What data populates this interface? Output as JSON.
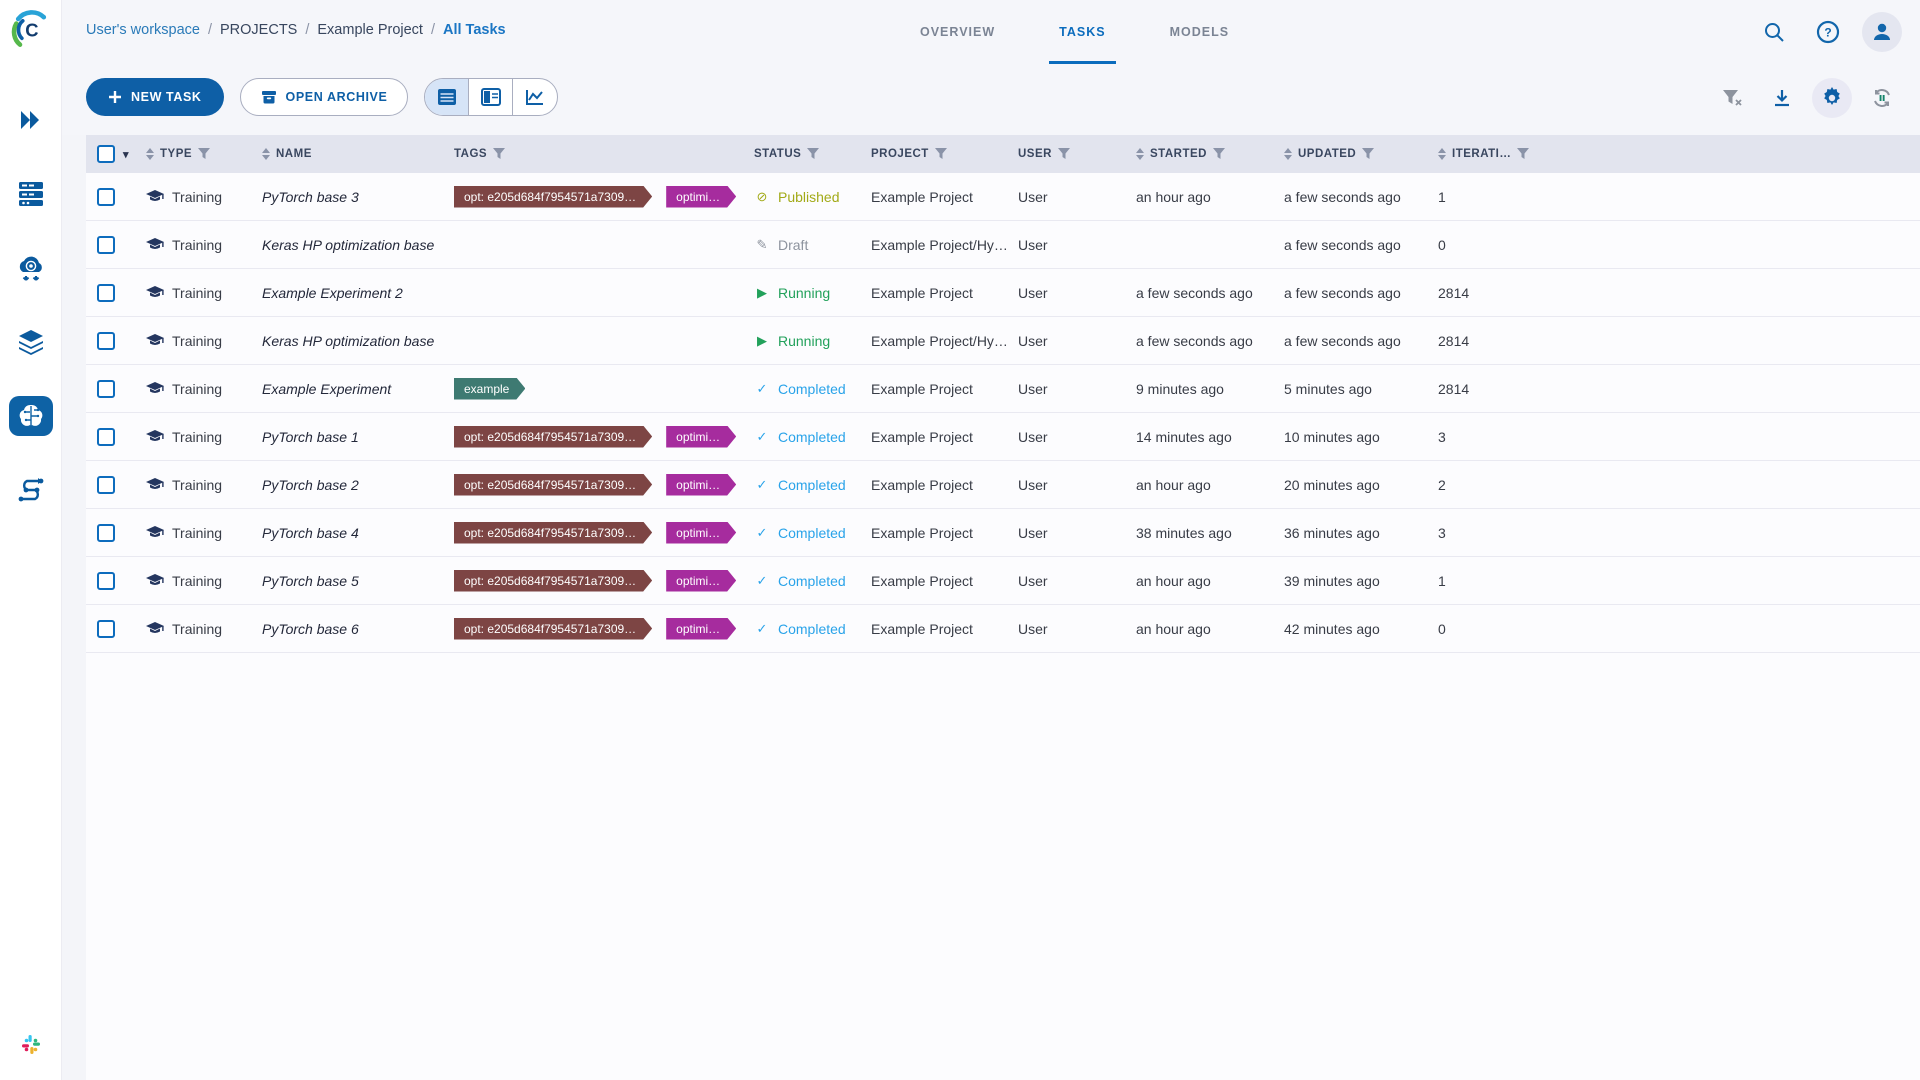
{
  "app": {
    "logo_letter": "C"
  },
  "colors": {
    "primary_blue": "#0e5fa6",
    "link_blue": "#2a7ab8",
    "active_tab_blue": "#0b6cbd",
    "header_bg": "#e2e4ee",
    "tag_maroon": "#7d4544",
    "tag_magenta": "#a62c9e",
    "tag_teal": "#3e7a72",
    "status_published": "#a2aa18",
    "status_draft": "#8d939e",
    "status_running": "#22a15b",
    "status_completed": "#29a3e9"
  },
  "sidebar": {
    "items": [
      "expand",
      "dashboard",
      "workers-and-queues",
      "datasets",
      "projects",
      "pipelines"
    ],
    "active_item": "projects",
    "bottom_item": "slack"
  },
  "topbar": {
    "breadcrumb": [
      {
        "label": "User's workspace",
        "kind": "link"
      },
      {
        "label": "PROJECTS",
        "kind": "plain"
      },
      {
        "label": "Example Project",
        "kind": "plain"
      },
      {
        "label": "All Tasks",
        "kind": "current"
      }
    ],
    "separator": "/",
    "tabs": [
      {
        "label": "OVERVIEW",
        "active": false
      },
      {
        "label": "TASKS",
        "active": true
      },
      {
        "label": "MODELS",
        "active": false
      }
    ]
  },
  "toolbar": {
    "new_task_label": "NEW TASK",
    "open_archive_label": "OPEN ARCHIVE",
    "view_options": [
      "table-view",
      "split-view",
      "compare-view"
    ],
    "active_view": "table-view",
    "right_icons": [
      "clear-filters",
      "download",
      "settings",
      "auto-refresh"
    ]
  },
  "table": {
    "header": {
      "select_caret": "▾",
      "columns": [
        {
          "id": "type",
          "label": "TYPE",
          "sortable": true,
          "filterable": true
        },
        {
          "id": "name",
          "label": "NAME",
          "sortable": true,
          "filterable": false
        },
        {
          "id": "tags",
          "label": "TAGS",
          "sortable": false,
          "filterable": true
        },
        {
          "id": "status",
          "label": "STATUS",
          "sortable": false,
          "filterable": true
        },
        {
          "id": "project",
          "label": "PROJECT",
          "sortable": false,
          "filterable": true
        },
        {
          "id": "user",
          "label": "USER",
          "sortable": false,
          "filterable": true
        },
        {
          "id": "started",
          "label": "STARTED",
          "sortable": true,
          "filterable": true
        },
        {
          "id": "updated",
          "label": "UPDATED",
          "sortable": true,
          "filterable": true
        },
        {
          "id": "iterations",
          "label": "ITERATI…",
          "sortable": true,
          "filterable": true
        }
      ]
    },
    "status_icons": {
      "published": "⊘",
      "draft": "✎",
      "running": "▶",
      "completed": "✓"
    },
    "status_colors": {
      "published": "#a2aa18",
      "draft": "#8d939e",
      "running": "#22a15b",
      "completed": "#29a3e9"
    },
    "rows": [
      {
        "type": "Training",
        "name": "PyTorch base 3",
        "tags": [
          {
            "label": "opt: e205d684f7954571a7309…",
            "color": "#7d4544"
          },
          {
            "label": "optimi…",
            "color": "#a62c9e"
          }
        ],
        "status": "Published",
        "status_key": "published",
        "project": "Example Project",
        "user": "User",
        "started": "an hour ago",
        "updated": "a few seconds ago",
        "iterations": "1"
      },
      {
        "type": "Training",
        "name": "Keras HP optimization base",
        "tags": [],
        "status": "Draft",
        "status_key": "draft",
        "project": "Example Project/Hy…",
        "user": "User",
        "started": "",
        "updated": "a few seconds ago",
        "iterations": "0"
      },
      {
        "type": "Training",
        "name": "Example Experiment 2",
        "tags": [],
        "status": "Running",
        "status_key": "running",
        "project": "Example Project",
        "user": "User",
        "started": "a few seconds ago",
        "updated": "a few seconds ago",
        "iterations": "2814"
      },
      {
        "type": "Training",
        "name": "Keras HP optimization base",
        "tags": [],
        "status": "Running",
        "status_key": "running",
        "project": "Example Project/Hy…",
        "user": "User",
        "started": "a few seconds ago",
        "updated": "a few seconds ago",
        "iterations": "2814"
      },
      {
        "type": "Training",
        "name": "Example Experiment",
        "tags": [
          {
            "label": "example",
            "color": "#3e7a72"
          }
        ],
        "status": "Completed",
        "status_key": "completed",
        "project": "Example Project",
        "user": "User",
        "started": "9 minutes ago",
        "updated": "5 minutes ago",
        "iterations": "2814"
      },
      {
        "type": "Training",
        "name": "PyTorch base 1",
        "tags": [
          {
            "label": "opt: e205d684f7954571a7309…",
            "color": "#7d4544"
          },
          {
            "label": "optimi…",
            "color": "#a62c9e"
          }
        ],
        "status": "Completed",
        "status_key": "completed",
        "project": "Example Project",
        "user": "User",
        "started": "14 minutes ago",
        "updated": "10 minutes ago",
        "iterations": "3"
      },
      {
        "type": "Training",
        "name": "PyTorch base 2",
        "tags": [
          {
            "label": "opt: e205d684f7954571a7309…",
            "color": "#7d4544"
          },
          {
            "label": "optimi…",
            "color": "#a62c9e"
          }
        ],
        "status": "Completed",
        "status_key": "completed",
        "project": "Example Project",
        "user": "User",
        "started": "an hour ago",
        "updated": "20 minutes ago",
        "iterations": "2"
      },
      {
        "type": "Training",
        "name": "PyTorch base 4",
        "tags": [
          {
            "label": "opt: e205d684f7954571a7309…",
            "color": "#7d4544"
          },
          {
            "label": "optimi…",
            "color": "#a62c9e"
          }
        ],
        "status": "Completed",
        "status_key": "completed",
        "project": "Example Project",
        "user": "User",
        "started": "38 minutes ago",
        "updated": "36 minutes ago",
        "iterations": "3"
      },
      {
        "type": "Training",
        "name": "PyTorch base 5",
        "tags": [
          {
            "label": "opt: e205d684f7954571a7309…",
            "color": "#7d4544"
          },
          {
            "label": "optimi…",
            "color": "#a62c9e"
          }
        ],
        "status": "Completed",
        "status_key": "completed",
        "project": "Example Project",
        "user": "User",
        "started": "an hour ago",
        "updated": "39 minutes ago",
        "iterations": "1"
      },
      {
        "type": "Training",
        "name": "PyTorch base 6",
        "tags": [
          {
            "label": "opt: e205d684f7954571a7309…",
            "color": "#7d4544"
          },
          {
            "label": "optimi…",
            "color": "#a62c9e"
          }
        ],
        "status": "Completed",
        "status_key": "completed",
        "project": "Example Project",
        "user": "User",
        "started": "an hour ago",
        "updated": "42 minutes ago",
        "iterations": "0"
      }
    ]
  }
}
